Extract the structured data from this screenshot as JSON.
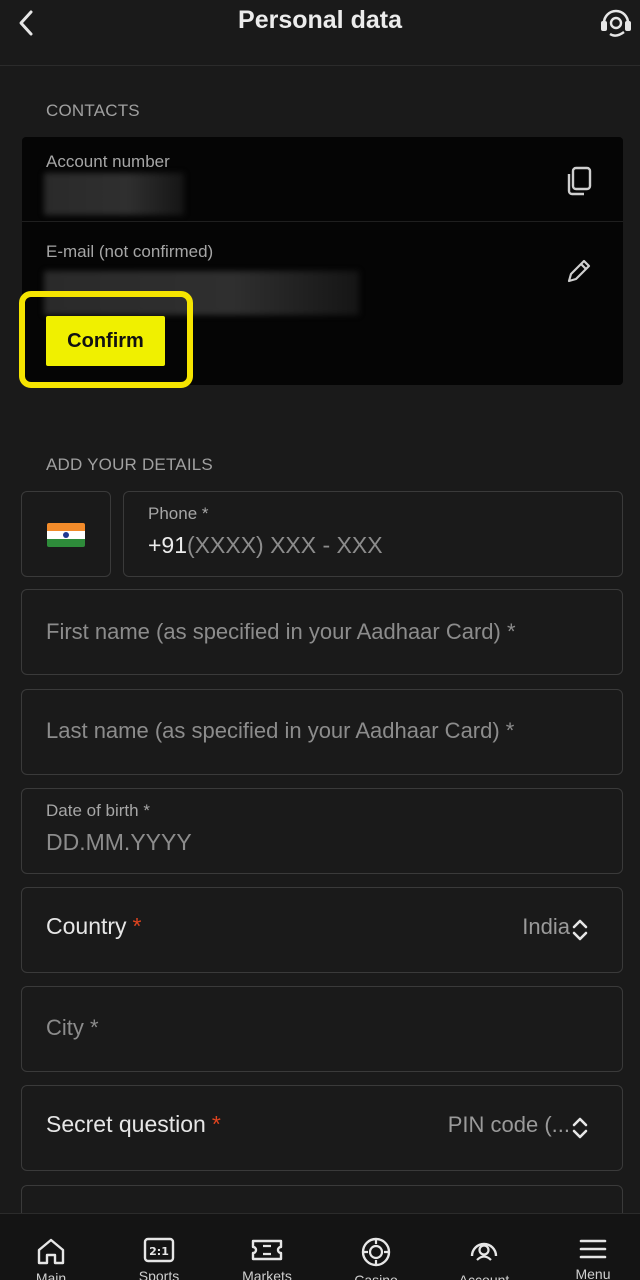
{
  "header": {
    "title": "Personal data",
    "back_icon": "chevron-left-icon",
    "support_icon": "headset-support-icon"
  },
  "contacts": {
    "section_label": "CONTACTS",
    "account_number_label": "Account number",
    "email_label": "E-mail (not confirmed)",
    "confirm_button": "Confirm",
    "copy_icon": "copy-icon",
    "edit_icon": "pencil-icon"
  },
  "details": {
    "section_label": "ADD YOUR DETAILS",
    "phone_label": "Phone *",
    "phone_prefix": "+91",
    "phone_placeholder": "(XXXX) XXX - XXX",
    "first_name_placeholder": "First name (as specified in your Aadhaar Card) *",
    "last_name_placeholder": "Last name (as specified in your Aadhaar Card) *",
    "dob_label": "Date of birth *",
    "dob_placeholder": "DD.MM.YYYY",
    "country_label": "Country",
    "country_value": "India",
    "city_placeholder": "City *",
    "secret_question_label": "Secret question",
    "secret_question_value": "PIN code (...",
    "required_mark": "*"
  },
  "bottom_nav": {
    "items": [
      {
        "label": "Main",
        "icon": "home-icon"
      },
      {
        "label": "Sports",
        "icon": "scoreboard-icon"
      },
      {
        "label": "Markets",
        "icon": "ticket-icon"
      },
      {
        "label": "Casino",
        "icon": "casino-chip-icon"
      },
      {
        "label": "Account",
        "icon": "user-icon"
      },
      {
        "label": "Menu",
        "icon": "hamburger-menu-icon"
      }
    ]
  },
  "colors": {
    "accent_yellow": "#f0f000",
    "highlight_yellow": "#f5e400",
    "required_red": "#e0441f",
    "background": "#1a1a1a"
  }
}
